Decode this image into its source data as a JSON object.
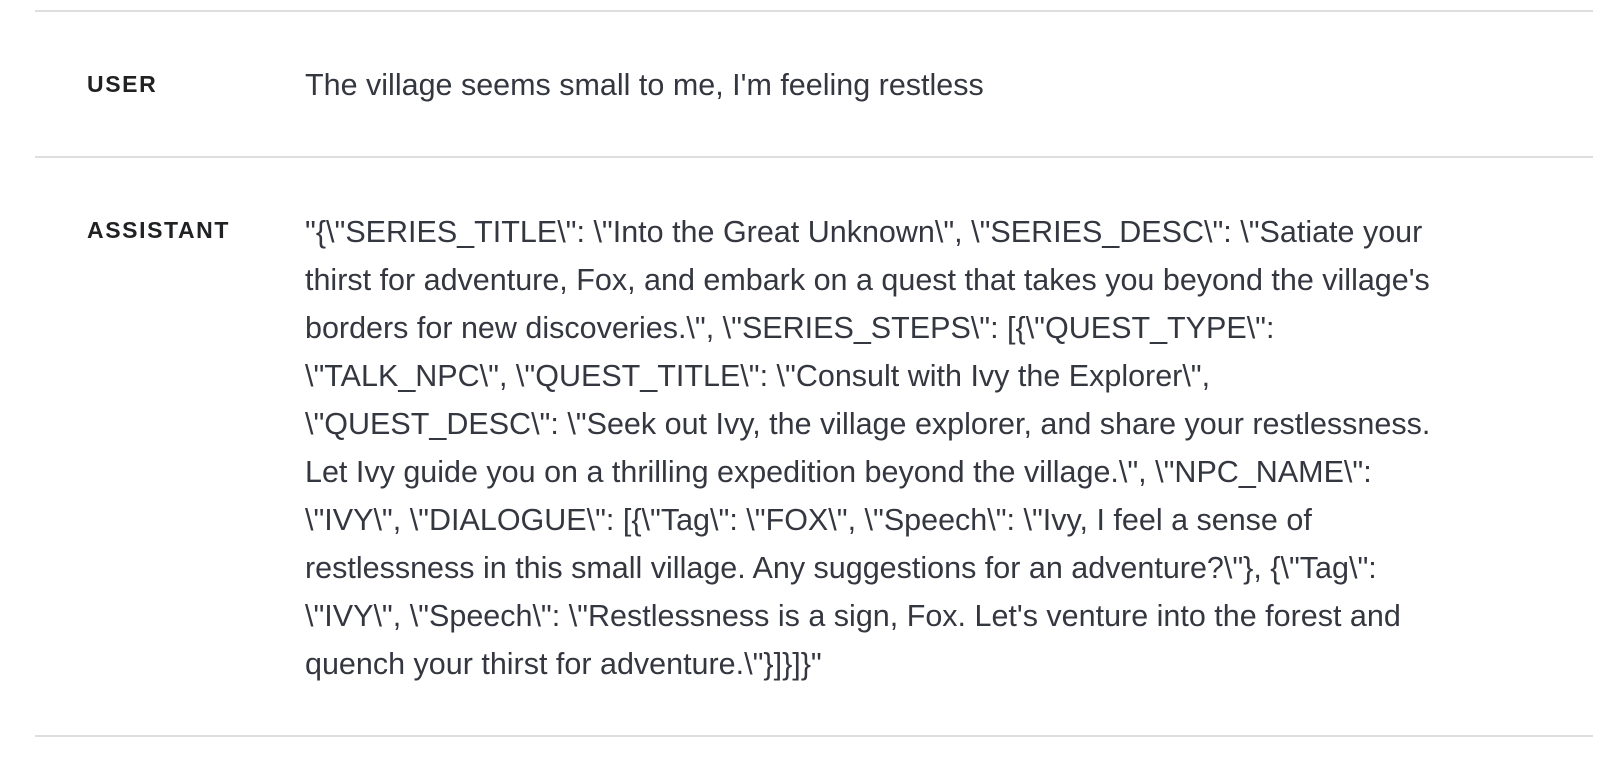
{
  "messages": [
    {
      "role": "USER",
      "content": "The village seems small to me, I'm feeling restless"
    },
    {
      "role": "ASSISTANT",
      "content": "\"{\\\"SERIES_TITLE\\\": \\\"Into the Great Unknown\\\", \\\"SERIES_DESC\\\": \\\"Satiate your thirst for adventure, Fox, and embark on a quest that takes you beyond the village's borders for new discoveries.\\\", \\\"SERIES_STEPS\\\": [{\\\"QUEST_TYPE\\\": \\\"TALK_NPC\\\", \\\"QUEST_TITLE\\\": \\\"Consult with Ivy the Explorer\\\", \\\"QUEST_DESC\\\": \\\"Seek out Ivy, the village explorer, and share your restlessness. Let Ivy guide you on a thrilling expedition beyond the village.\\\", \\\"NPC_NAME\\\": \\\"IVY\\\", \\\"DIALOGUE\\\": [{\\\"Tag\\\": \\\"FOX\\\", \\\"Speech\\\": \\\"Ivy, I feel a sense of restlessness in this small village. Any suggestions for an adventure?\\\"}, {\\\"Tag\\\": \\\"IVY\\\", \\\"Speech\\\": \\\"Restlessness is a sign, Fox. Let's venture into the forest and quench your thirst for adventure.\\\"}]}]}\""
    }
  ]
}
